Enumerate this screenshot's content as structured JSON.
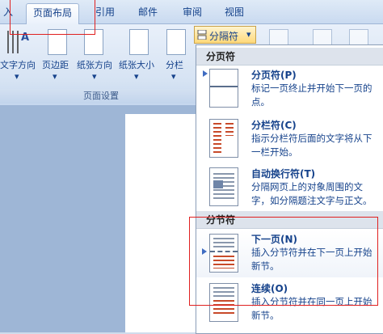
{
  "tabs": [
    "入",
    "页面布局",
    "引用",
    "邮件",
    "审阅",
    "视图"
  ],
  "ribbon": {
    "buttons": [
      "文字方向",
      "页边距",
      "纸张方向",
      "纸张大小",
      "分栏"
    ],
    "breaks_button": "分隔符",
    "group_label": "页面设置"
  },
  "dropdown": {
    "page_breaks_header": "分页符",
    "section_breaks_header": "分节符",
    "items": [
      {
        "title": "分页符(P)",
        "desc": "标记一页终止并开始下一页的点。"
      },
      {
        "title": "分栏符(C)",
        "desc": "指示分栏符后面的文字将从下一栏开始。"
      },
      {
        "title": "自动换行符(T)",
        "desc": "分隔网页上的对象周围的文字，如分隔题注文字与正文。"
      },
      {
        "title": "下一页(N)",
        "desc": "插入分节符并在下一页上开始新节。"
      },
      {
        "title": "连续(O)",
        "desc": "插入分节符并在同一页上开始新节。"
      }
    ]
  },
  "colors": {
    "annotation_box": "#e02020",
    "menu_text": "#15428b",
    "ribbon_bg": "#d6e3f3"
  }
}
